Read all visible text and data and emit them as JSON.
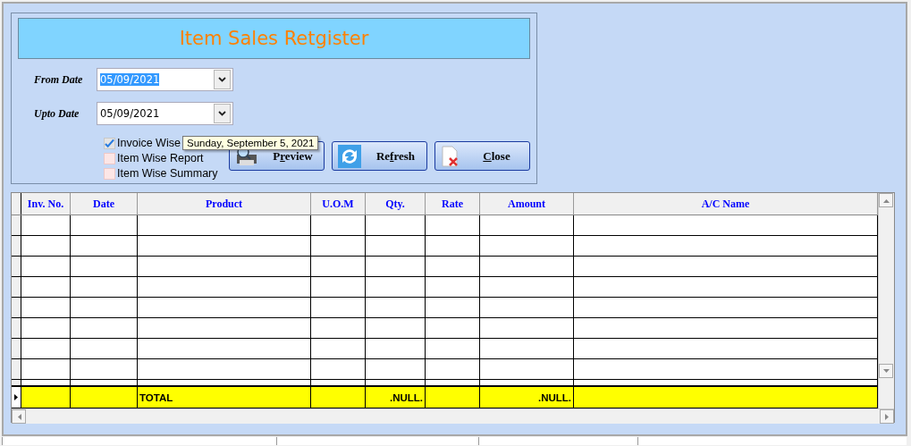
{
  "title": "Item Sales Retgister",
  "date_fields": [
    {
      "label": "From Date",
      "value": "05/09/2021",
      "selected": true
    },
    {
      "label": "Upto Date",
      "value": "05/09/2021",
      "selected": false
    }
  ],
  "options": [
    {
      "label": "Invoice Wise",
      "checked": true
    },
    {
      "label": "Item Wise Report",
      "checked": false
    },
    {
      "label": "Item Wise Summary",
      "checked": false
    }
  ],
  "tooltip": "Sunday, September 5, 2021",
  "buttons": [
    {
      "kind": "preview",
      "before": "P",
      "key": "r",
      "after": "eview"
    },
    {
      "kind": "refresh",
      "before": "Re",
      "key": "f",
      "after": "resh"
    },
    {
      "kind": "close",
      "key": "C",
      "after": "lose"
    }
  ],
  "table": {
    "columns": [
      "Inv. No.",
      "Date",
      "Product",
      "U.O.M",
      "Qty.",
      "Rate",
      "Amount",
      "A/C Name"
    ],
    "total_row": {
      "product": "TOTAL",
      "qty": ".NULL.",
      "amount": ".NULL."
    }
  }
}
